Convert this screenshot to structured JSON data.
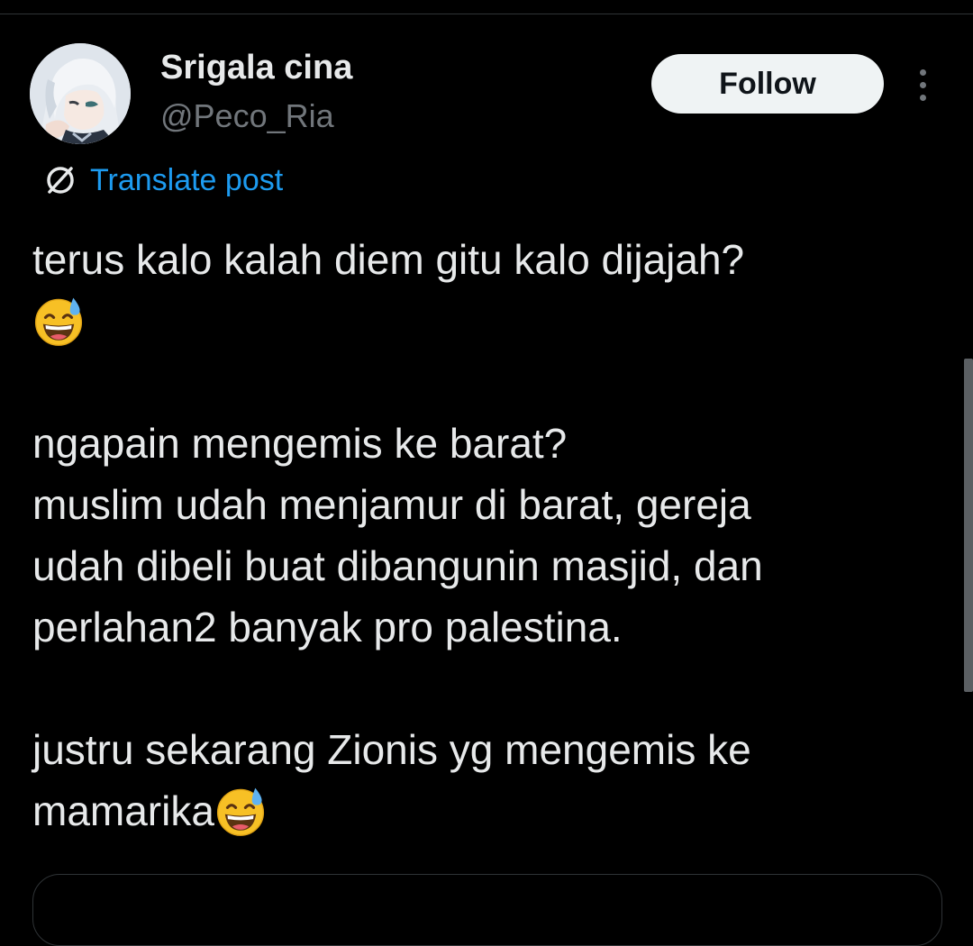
{
  "author": {
    "display_name": "Srigala cina",
    "handle": "@Peco_Ria",
    "avatar_icon": "anime-character-avatar"
  },
  "actions": {
    "follow_label": "Follow",
    "more_icon": "more-vertical-icon"
  },
  "translate": {
    "label": "Translate post",
    "icon": "translate-globe-icon"
  },
  "post": {
    "lines": [
      "terus kalo kalah diem gitu kalo dijajah?",
      "ngapain mengemis ke barat?",
      "muslim udah menjamur di barat, gereja",
      "udah dibeli buat dibangunin masjid, dan",
      "perlahan2 banyak pro palestina.",
      "justru sekarang Zionis yg mengemis ke",
      "mamarika"
    ],
    "emoji": "grinning-face-with-sweat"
  },
  "colors": {
    "background": "#000000",
    "text_primary": "#e7e9ea",
    "text_secondary": "#71767b",
    "link": "#1d9bf0",
    "follow_bg": "#eff3f4",
    "follow_text": "#0f1419",
    "border": "#2f3336"
  }
}
